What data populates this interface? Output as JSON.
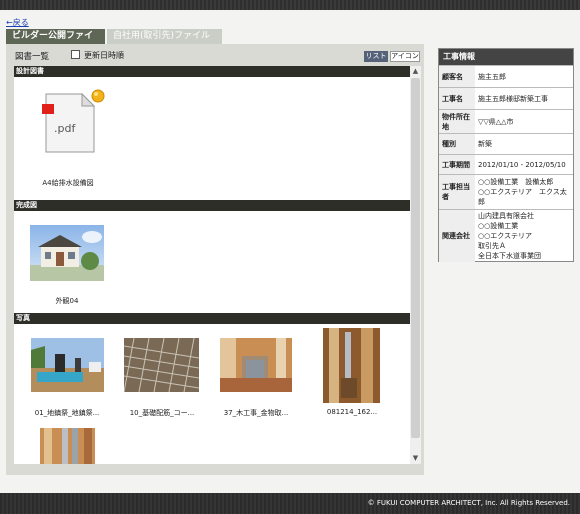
{
  "nav": {
    "back_label": "←戻る"
  },
  "tabs": [
    {
      "label": "ビルダー公開ファイル"
    },
    {
      "label": "自社用(取引先)ファイル"
    }
  ],
  "toolbar": {
    "title": "図書一覧",
    "sort_label": "更新日時順",
    "list_label": "リスト",
    "icon_label": "アイコン"
  },
  "sections": [
    {
      "title": "設計図書",
      "items": [
        {
          "caption": "A4給排水設備図",
          "icon": "pdf-icon"
        }
      ]
    },
    {
      "title": "完成図",
      "items": [
        {
          "caption": "外観04"
        }
      ]
    },
    {
      "title": "写真",
      "items": [
        {
          "caption": "01_地鎮祭_地鎮祭..."
        },
        {
          "caption": "10_基礎配筋_コー..."
        },
        {
          "caption": "37_木工事_金物取..."
        },
        {
          "caption": "081214_162..."
        },
        {
          "caption": ""
        }
      ]
    }
  ],
  "info": {
    "header": "工事情報",
    "rows": [
      {
        "label": "顧客名",
        "value": [
          "施主五郎"
        ]
      },
      {
        "label": "工事名",
        "value": [
          "施主五郎様邸新築工事"
        ]
      },
      {
        "label": "物件所在地",
        "value": [
          "▽▽県△△市"
        ]
      },
      {
        "label": "種別",
        "value": [
          "新築"
        ]
      },
      {
        "label": "工事期間",
        "value": [
          "2012/01/10 - 2012/05/10"
        ]
      },
      {
        "label": "工事担当者",
        "value": [
          "○○設備工業　設備太郎",
          "○○エクステリア　エクス太郎"
        ]
      },
      {
        "label": "関連会社",
        "value": [
          "山内建具有限会社",
          "○○設備工業",
          "○○エクステリア",
          "取引先Ａ",
          "全日本下水道事業団"
        ]
      }
    ]
  },
  "footer": {
    "copyright": "© FUKUI COMPUTER ARCHITECT, Inc. All Rights Reserved."
  },
  "colors": {
    "tab_active": "#5e6655",
    "tab_inactive": "#c9cfc6",
    "section_bar": "#2e2e28",
    "list_button": "#56627a"
  }
}
